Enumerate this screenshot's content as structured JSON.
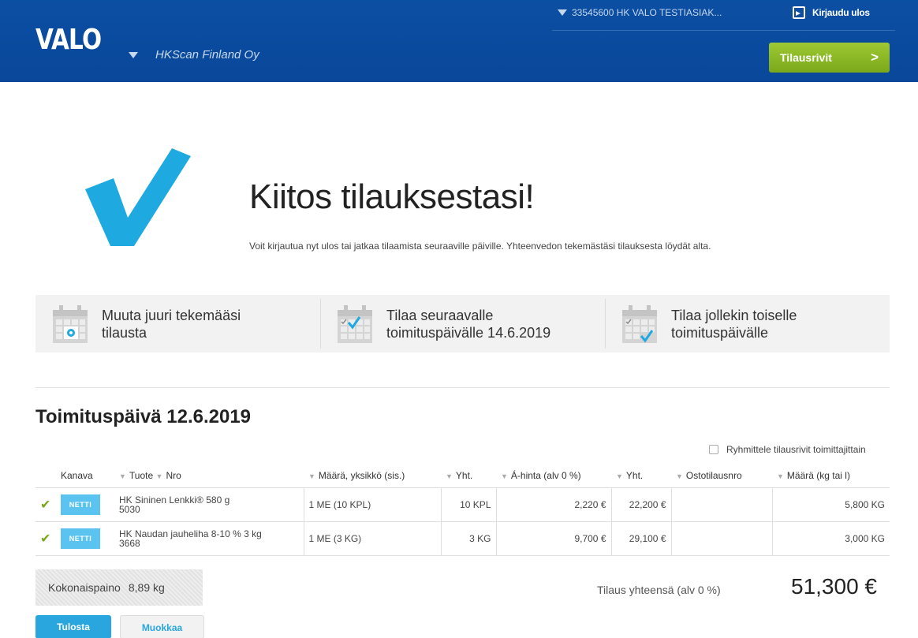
{
  "header": {
    "logo": "VALO",
    "company": "HKScan Finland Oy",
    "customer": "33545600 HK VALO TESTIASIAK...",
    "logout": "Kirjaudu ulos",
    "cart_button": "Tilausrivit"
  },
  "confirmation": {
    "title": "Kiitos tilauksestasi!",
    "text": "Voit kirjautua nyt ulos tai jatkaa tilaamista seuraaville päiville. Yhteenvedon tekemästäsi tilauksesta löydät alta."
  },
  "actions": [
    {
      "line1": "Muuta juuri tekemääsi",
      "line2": "tilausta",
      "icon": "calendar-gear-icon"
    },
    {
      "line1": "Tilaa seuraavalle",
      "line2": "toimituspäivälle 14.6.2019",
      "icon": "calendar-check-icon"
    },
    {
      "line1": "Tilaa jollekin toiselle",
      "line2": "toimituspäivälle",
      "icon": "calendar-check-corner-icon"
    }
  ],
  "delivery": {
    "title": "Toimituspäivä 12.6.2019",
    "group_toggle": "Ryhmittele tilausrivit toimittajittain"
  },
  "table": {
    "headers": {
      "kanava": "Kanava",
      "tuote": "Tuote",
      "nro": "Nro",
      "maara": "Määrä, yksikkö (sis.)",
      "yht": "Yht.",
      "ahinta": "Á-hinta (alv 0 %)",
      "yht2": "Yht.",
      "ostotilausnro": "Ostotilausnro",
      "maara_kg": "Määrä (kg tai l)"
    },
    "rows": [
      {
        "channel": "NETTI",
        "product": "HK Sininen Lenkki® 580 g",
        "nro": "5030",
        "qty": "1 ME (10 KPL)",
        "total_qty": "10 KPL",
        "unit_price": "2,220 €",
        "total": "22,200 €",
        "po": "",
        "weight": "5,800 KG"
      },
      {
        "channel": "NETTI",
        "product": "HK Naudan jauheliha 8-10 % 3 kg",
        "nro": "3668",
        "qty": "1 ME (3 KG)",
        "total_qty": "3 KG",
        "unit_price": "9,700 €",
        "total": "29,100 €",
        "po": "",
        "weight": "3,000 KG"
      }
    ]
  },
  "summary": {
    "weight_label": "Kokonaispaino",
    "weight_value": "8,89 kg",
    "total_label": "Tilaus yhteensä (alv 0 %)",
    "total_value": "51,300 €"
  },
  "buttons": {
    "print": "Tulosta",
    "edit": "Muokkaa"
  },
  "colors": {
    "header": "#0b4fa3",
    "accent_green": "#8ab82a",
    "accent_blue": "#2aa6de",
    "check_blue": "#1fa9e1"
  }
}
